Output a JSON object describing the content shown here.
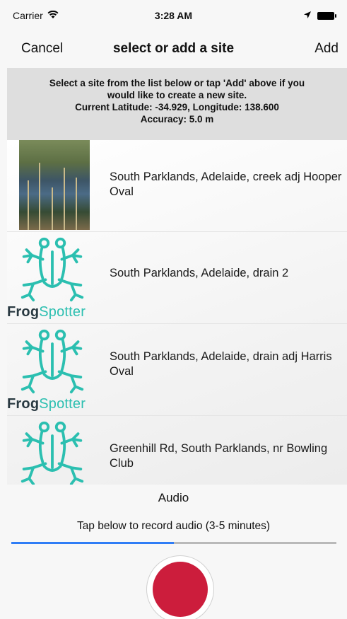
{
  "status": {
    "carrier": "Carrier",
    "time": "3:28 AM",
    "icons": [
      "wifi-icon",
      "location-arrow-icon",
      "battery-icon"
    ]
  },
  "nav": {
    "cancel_label": "Cancel",
    "title": "select or add a site",
    "add_label": "Add"
  },
  "info": {
    "instructions": "Select a site from the list below or tap 'Add' above if you\nwould like to create a new site.",
    "location": "Current Latitude: -34.929, Longitude: 138.600",
    "accuracy": "Accuracy: 5.0 m"
  },
  "brand": {
    "frog": "Frog",
    "spotter": "Spotter"
  },
  "sites": [
    {
      "label": "South Parklands, Adelaide, creek adj Hooper Oval",
      "thumbnail": "photo"
    },
    {
      "label": "South Parklands, Adelaide, drain 2",
      "thumbnail": "frogspotter-logo"
    },
    {
      "label": "South Parklands, Adelaide, drain adj Harris Oval",
      "thumbnail": "frogspotter-logo"
    },
    {
      "label": "Greenhill Rd, South Parklands, nr Bowling Club",
      "thumbnail": "frogspotter-logo"
    }
  ],
  "audio": {
    "title": "Audio",
    "hint": "Tap below to record audio (3-5 minutes)",
    "progress": 0.5
  },
  "colors": {
    "accent": "#2f7df6",
    "record": "#cc1d3c",
    "frog": "#2bbfb0",
    "info_bg": "#dedede"
  }
}
